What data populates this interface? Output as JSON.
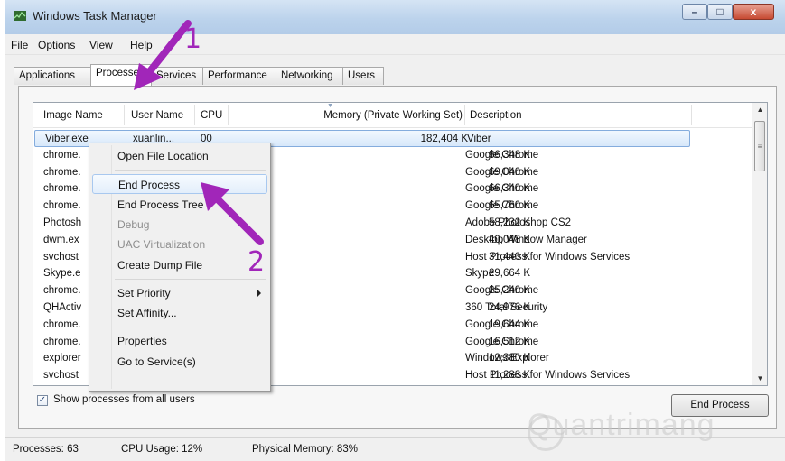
{
  "window": {
    "title": "Windows Task Manager",
    "controls": {
      "minimize": "–",
      "maximize": "□",
      "close": "x"
    }
  },
  "menu": [
    "File",
    "Options",
    "View",
    "Help"
  ],
  "tabs": [
    {
      "label": "Applications",
      "active": false
    },
    {
      "label": "Processes",
      "active": true
    },
    {
      "label": "Services",
      "active": false
    },
    {
      "label": "Performance",
      "active": false
    },
    {
      "label": "Networking",
      "active": false
    },
    {
      "label": "Users",
      "active": false
    }
  ],
  "table": {
    "columns": [
      "Image Name",
      "User Name",
      "CPU",
      "Memory (Private Working Set)",
      "Description"
    ],
    "rows": [
      {
        "name": "Viber.exe",
        "user": "xuanlin...",
        "cpu": "00",
        "mem": "182,404 K",
        "desc": "Viber",
        "selected": true
      },
      {
        "name": "chrome.",
        "user": "",
        "cpu": "",
        "mem": "86,348 K",
        "desc": "Google Chrome"
      },
      {
        "name": "chrome.",
        "user": "",
        "cpu": "",
        "mem": "69,040 K",
        "desc": "Google Chrome"
      },
      {
        "name": "chrome.",
        "user": "",
        "cpu": "",
        "mem": "66,340 K",
        "desc": "Google Chrome"
      },
      {
        "name": "chrome.",
        "user": "",
        "cpu": "",
        "mem": "65,760 K",
        "desc": "Google Chrome"
      },
      {
        "name": "Photosh",
        "user": "",
        "cpu": "",
        "mem": "58,232 K",
        "desc": "Adobe Photoshop CS2"
      },
      {
        "name": "dwm.ex",
        "user": "",
        "cpu": "",
        "mem": "40,048 K",
        "desc": "Desktop Window Manager"
      },
      {
        "name": "svchost",
        "user": "",
        "cpu": "",
        "mem": "31,440 K",
        "desc": "Host Process for Windows Services"
      },
      {
        "name": "Skype.e",
        "user": "",
        "cpu": "",
        "mem": "29,664 K",
        "desc": "Skype"
      },
      {
        "name": "chrome.",
        "user": "",
        "cpu": "",
        "mem": "25,240 K",
        "desc": "Google Chrome"
      },
      {
        "name": "QHActiv",
        "user": "",
        "cpu": "",
        "mem": "24,976 K",
        "desc": "360 Total Security"
      },
      {
        "name": "chrome.",
        "user": "",
        "cpu": "",
        "mem": "19,644 K",
        "desc": "Google Chrome"
      },
      {
        "name": "chrome.",
        "user": "",
        "cpu": "",
        "mem": "16,512 K",
        "desc": "Google Chrome"
      },
      {
        "name": "explorer",
        "user": "",
        "cpu": "",
        "mem": "12,380 K",
        "desc": "Windows Explorer"
      },
      {
        "name": "svchost",
        "user": "",
        "cpu": "",
        "mem": "11,288 K",
        "desc": "Host Process for Windows Services"
      }
    ]
  },
  "context_menu": {
    "groups": [
      [
        {
          "label": "Open File Location",
          "enabled": true
        }
      ],
      [
        {
          "label": "End Process",
          "enabled": true,
          "highlighted": true
        },
        {
          "label": "End Process Tree",
          "enabled": true
        },
        {
          "label": "Debug",
          "enabled": false
        },
        {
          "label": "UAC Virtualization",
          "enabled": false
        },
        {
          "label": "Create Dump File",
          "enabled": true
        }
      ],
      [
        {
          "label": "Set Priority",
          "enabled": true,
          "submenu": true
        },
        {
          "label": "Set Affinity...",
          "enabled": true
        }
      ],
      [
        {
          "label": "Properties",
          "enabled": true
        },
        {
          "label": "Go to Service(s)",
          "enabled": true
        }
      ]
    ]
  },
  "show_all": {
    "label": "Show processes from all users",
    "checked": true,
    "check_glyph": "✓"
  },
  "end_process_button": "End Process",
  "status": {
    "processes": "Processes: 63",
    "cpu": "CPU Usage: 12%",
    "memory": "Physical Memory: 83%"
  },
  "annotations": {
    "number_1": "1",
    "number_2": "2",
    "color": "#a126b9"
  },
  "scrollbar": {
    "up": "▲",
    "down": "▼",
    "grip": "≡"
  },
  "watermark": "Quantrimang"
}
